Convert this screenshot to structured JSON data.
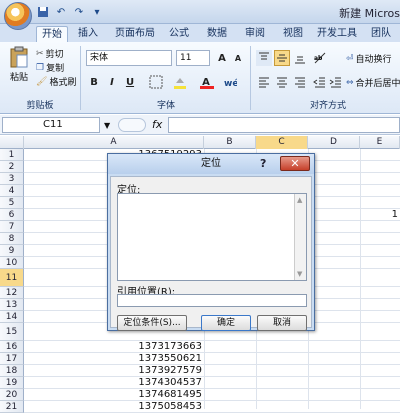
{
  "title_bar": {
    "title": "新建 Micros"
  },
  "quick_access": [
    "save-icon",
    "undo-icon",
    "redo-icon",
    "customize-icon"
  ],
  "tabs": [
    "开始",
    "插入",
    "页面布局",
    "公式",
    "数据",
    "审阅",
    "视图",
    "开发工具",
    "团队"
  ],
  "ribbon": {
    "clipboard": {
      "paste": "粘贴",
      "cut": "剪切",
      "copy": "复制",
      "format_painter": "格式刷",
      "label": "剪贴板"
    },
    "font": {
      "name": "宋体",
      "size": "11",
      "label": "字体",
      "bold": "B",
      "italic": "I",
      "underline": "U",
      "grow": "A",
      "shrink": "A"
    },
    "alignment": {
      "wrap": "自动换行",
      "merge": "合并后居中",
      "label": "对齐方式"
    }
  },
  "formula_bar": {
    "name_box": "C11",
    "fx": "fx",
    "value": ""
  },
  "columns": [
    "A",
    "B",
    "C",
    "D",
    "E"
  ],
  "rows": [
    "1",
    "2",
    "3",
    "4",
    "5",
    "6",
    "7",
    "8",
    "9",
    "10",
    "11",
    "12",
    "13",
    "14",
    "15",
    "16",
    "17",
    "18",
    "19",
    "20",
    "21"
  ],
  "cells": {
    "a1": "1367519293",
    "e6": "1",
    "a16": "1373173663",
    "a17": "1373550621",
    "a18": "1373927579",
    "a19": "1374304537",
    "a20": "1374681495",
    "a21": "1375058453"
  },
  "dialog": {
    "title": "定位",
    "help": "?",
    "close": "✕",
    "goto_label": "定位:",
    "reference_label": "引用位置(R):",
    "reference_value": "",
    "special_button": "定位条件(S)...",
    "ok_button": "确定",
    "cancel_button": "取消"
  }
}
